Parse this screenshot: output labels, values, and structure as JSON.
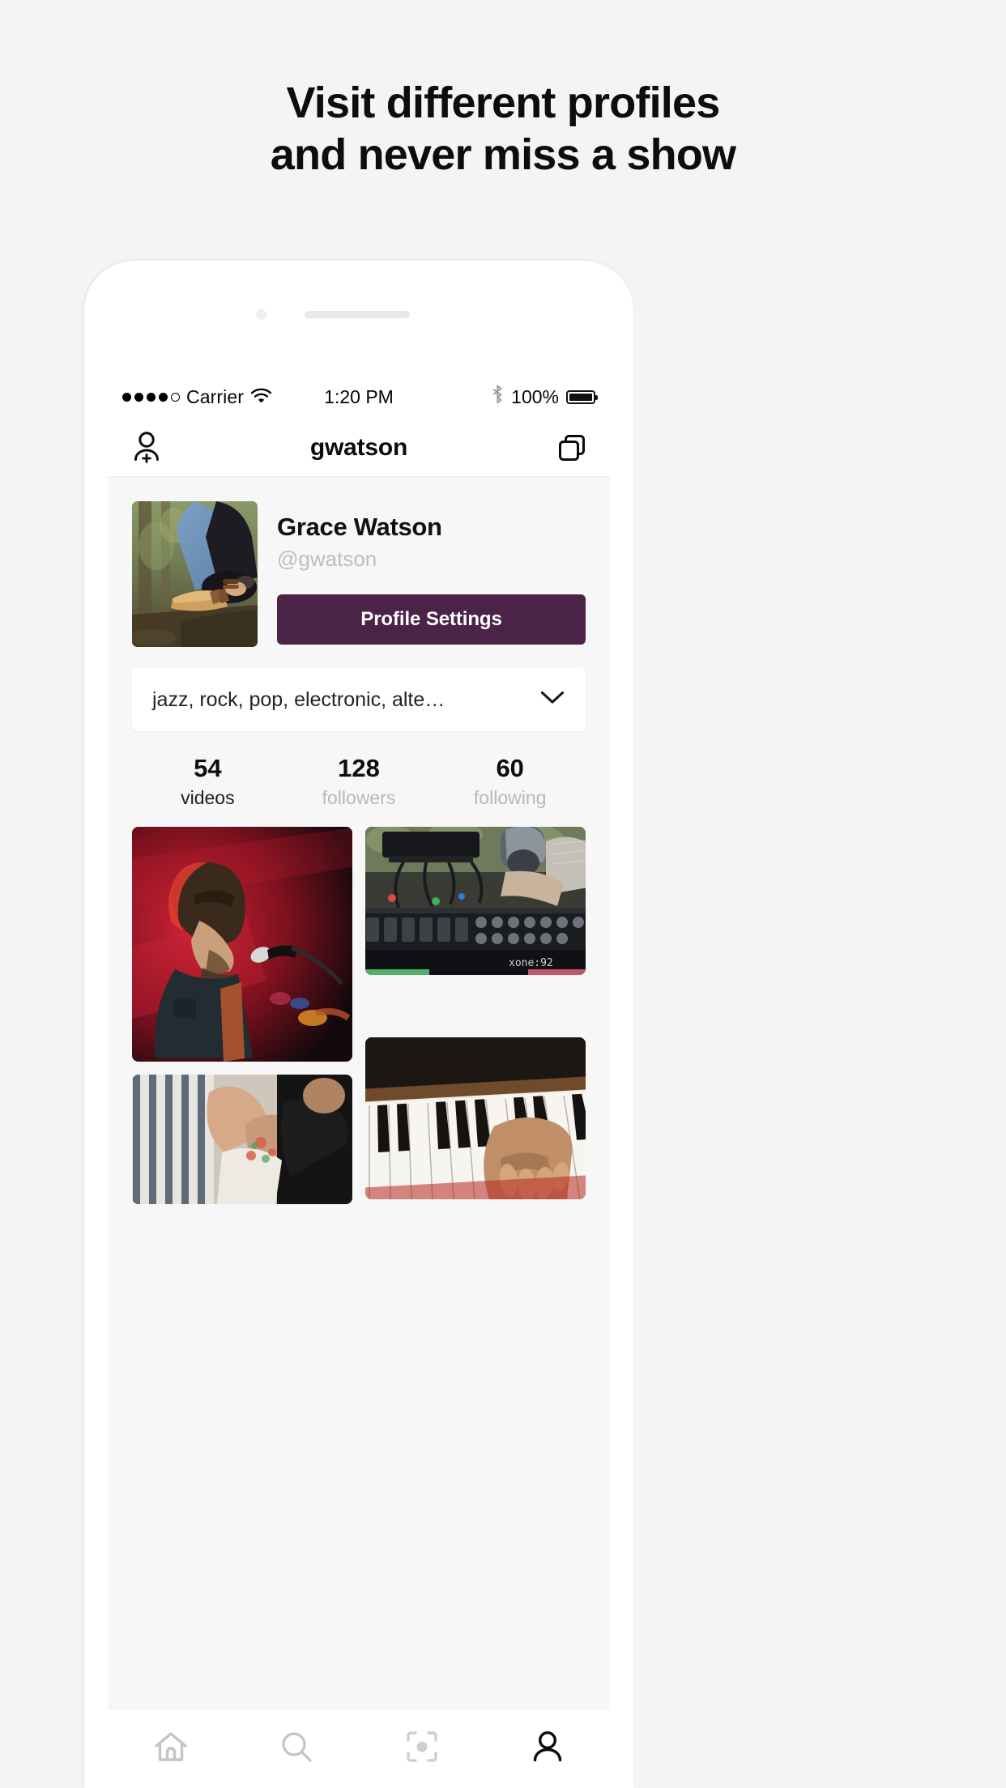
{
  "headline": {
    "line1": "Visit different profiles",
    "line2": "and never miss a show"
  },
  "phone": {
    "status_bar": {
      "carrier": "Carrier",
      "time": "1:20 PM",
      "battery_percent": "100%",
      "signal_dots_filled": 4,
      "signal_dots_total": 5,
      "wifi_icon": "wifi-icon",
      "bluetooth_icon": "bluetooth-icon",
      "battery_icon": "battery-full-icon"
    },
    "nav_bar": {
      "title": "gwatson",
      "left_icon": "add-person-icon",
      "right_icon": "copy-icon"
    },
    "profile": {
      "avatar_alt": "woman-sitting-on-tree-stump-in-forest",
      "name": "Grace Watson",
      "handle": "@gwatson",
      "settings_button": "Profile Settings"
    },
    "genre_select": {
      "value": "jazz, rock, pop, electronic, alte…",
      "chevron_icon": "chevron-down-icon"
    },
    "stats": [
      {
        "value": "54",
        "label": "videos"
      },
      {
        "value": "128",
        "label": "followers"
      },
      {
        "value": "60",
        "label": "following"
      }
    ],
    "gallery": [
      {
        "alt": "singer-with-microphone-red-stage-light"
      },
      {
        "alt": "dj-mixing-deck-xone-92"
      },
      {
        "alt": "crowd-at-concert"
      },
      {
        "alt": "hands-playing-piano-keys"
      }
    ],
    "tab_bar": [
      {
        "name": "home",
        "icon": "home-icon",
        "active": false
      },
      {
        "name": "search",
        "icon": "search-icon",
        "active": false
      },
      {
        "name": "capture",
        "icon": "camera-capture-icon",
        "active": false
      },
      {
        "name": "profile",
        "icon": "person-icon",
        "active": true
      }
    ]
  },
  "colors": {
    "page_background": "#f4f4f4",
    "accent_purple": "#4b2346",
    "text_primary": "#0d0d0d",
    "text_muted": "#b8b8b8",
    "screen_background": "#f7f7f7"
  }
}
